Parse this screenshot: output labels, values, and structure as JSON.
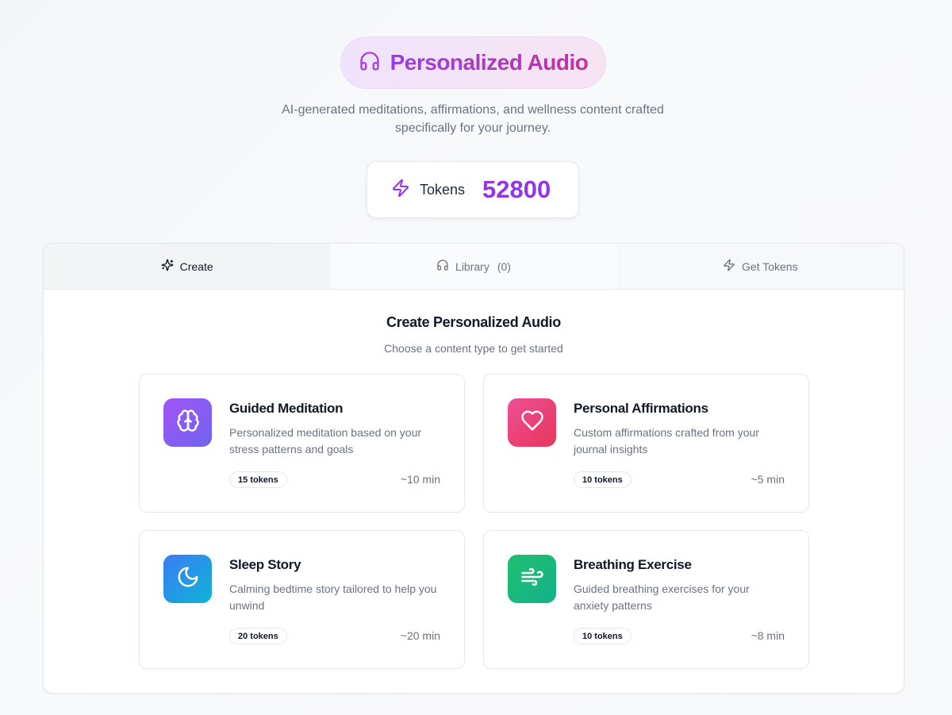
{
  "header": {
    "title": "Personalized Audio",
    "subtitle": "AI-generated meditations, affirmations, and wellness content crafted specifically for your journey."
  },
  "tokens": {
    "label": "Tokens",
    "value": "52800"
  },
  "tabs": [
    {
      "label": "Create",
      "icon": "sparkles-icon",
      "active": true
    },
    {
      "label": "Library",
      "count": "(0)",
      "icon": "headphones-icon"
    },
    {
      "label": "Get Tokens",
      "icon": "zap-icon"
    }
  ],
  "create": {
    "title": "Create Personalized Audio",
    "subtitle": "Choose a content type to get started",
    "cards": [
      {
        "title": "Guided Meditation",
        "description": "Personalized meditation based on your stress patterns and goals",
        "tokens": "15 tokens",
        "duration": "~10 min",
        "icon": "brain-icon",
        "color": "#a155f7"
      },
      {
        "title": "Personal Affirmations",
        "description": "Custom affirmations crafted from your journal insights",
        "tokens": "10 tokens",
        "duration": "~5 min",
        "icon": "heart-icon",
        "color": "#ee4e98"
      },
      {
        "title": "Sleep Story",
        "description": "Calming bedtime story tailored to help you unwind",
        "tokens": "20 tokens",
        "duration": "~20 min",
        "icon": "moon-icon",
        "color": "#3b7cf5"
      },
      {
        "title": "Breathing Exercise",
        "description": "Guided breathing exercises for your anxiety patterns",
        "tokens": "10 tokens",
        "duration": "~8 min",
        "icon": "wind-icon",
        "color": "#1fc070"
      }
    ]
  },
  "colors": {
    "accent": "#9333ea",
    "brand_gradient_start": "#9b3fe0",
    "brand_gradient_end": "#c2329f"
  }
}
